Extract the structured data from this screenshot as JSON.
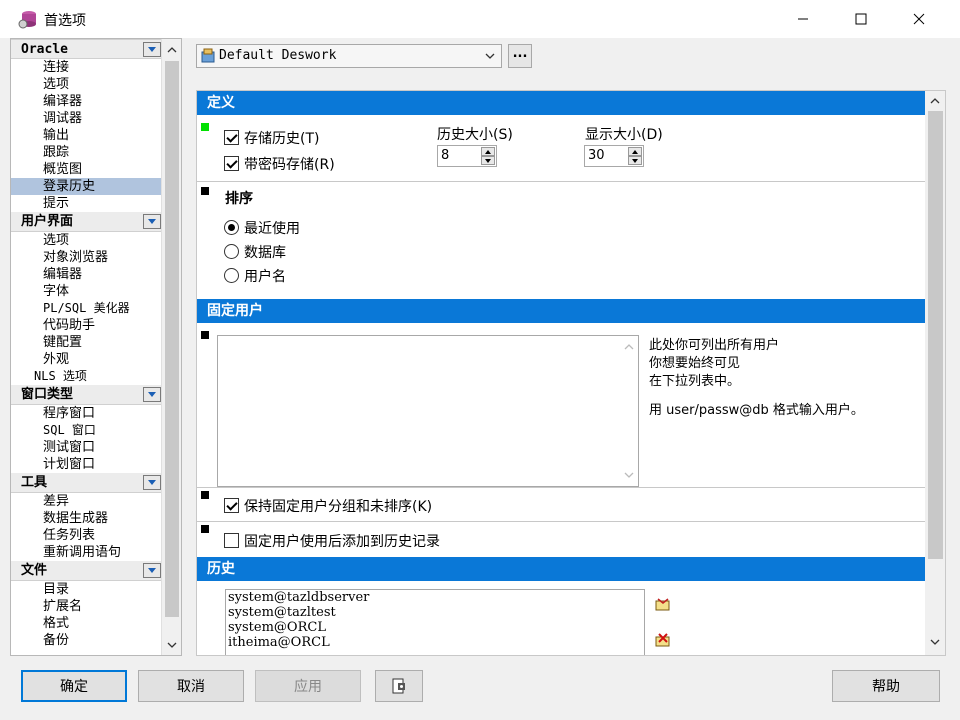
{
  "window": {
    "title": "首选项"
  },
  "tree": {
    "sections": [
      {
        "label": "Oracle",
        "items": [
          "连接",
          "选项",
          "编译器",
          "调试器",
          "输出",
          "跟踪",
          "概览图",
          "登录历史",
          "提示"
        ]
      },
      {
        "label": "用户界面",
        "items": [
          "选项",
          "对象浏览器",
          "编辑器",
          "字体",
          "PL/SQL 美化器",
          "代码助手",
          "键配置",
          "外观",
          "NLS 选项"
        ]
      },
      {
        "label": "窗口类型",
        "items": [
          "程序窗口",
          "SQL 窗口",
          "测试窗口",
          "计划窗口"
        ]
      },
      {
        "label": "工具",
        "items": [
          "差异",
          "数据生成器",
          "任务列表",
          "重新调用语句"
        ]
      },
      {
        "label": "文件",
        "items": [
          "目录",
          "扩展名",
          "格式",
          "备份"
        ]
      }
    ],
    "selected": "登录历史"
  },
  "profile": {
    "selected": "Default Deswork",
    "more_label": "..."
  },
  "definition": {
    "header": "定义",
    "store_history": {
      "label": "存储历史(T)",
      "checked": true
    },
    "store_with_password": {
      "label": "带密码存储(R)",
      "checked": true
    },
    "history_size": {
      "label": "历史大小(S)",
      "value": "8"
    },
    "display_size": {
      "label": "显示大小(D)",
      "value": "30"
    }
  },
  "sort": {
    "label": "排序",
    "options": [
      {
        "label": "最近使用",
        "checked": true
      },
      {
        "label": "数据库",
        "checked": false
      },
      {
        "label": "用户名",
        "checked": false
      }
    ]
  },
  "fixed_users": {
    "header": "固定用户",
    "desc_lines": [
      "此处你可列出所有用户",
      "你想要始终可见",
      "在下拉列表中。"
    ],
    "format_hint": "用 user/passw@db 格式输入用户。",
    "keep_grouped": {
      "label": "保持固定用户分组和未排序(K)",
      "checked": true
    },
    "add_to_history": {
      "label": "固定用户使用后添加到历史记录",
      "checked": false
    }
  },
  "history": {
    "header": "历史",
    "entries": [
      "system@tazldbserver",
      "system@tazltest",
      "system@ORCL",
      "itheima@ORCL"
    ]
  },
  "buttons": {
    "ok": "确定",
    "cancel": "取消",
    "apply": "应用",
    "help": "帮助"
  },
  "colors": {
    "section_header": "#0a78d7",
    "selection": "#b0c4de"
  }
}
